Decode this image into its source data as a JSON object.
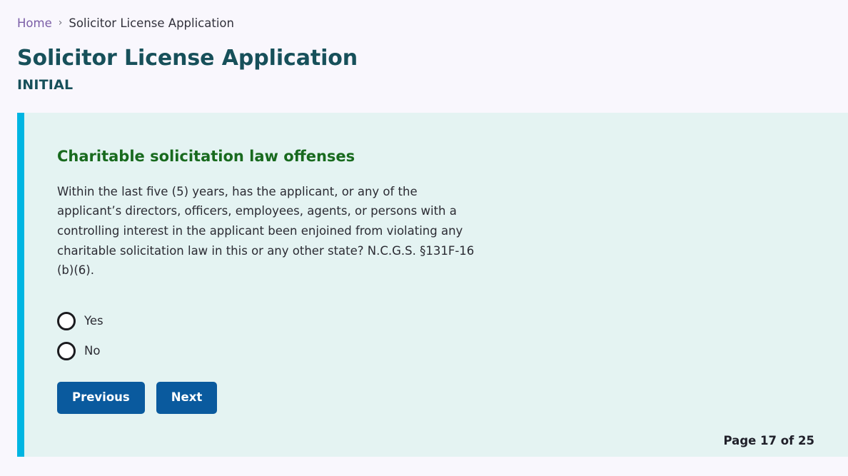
{
  "breadcrumb": {
    "home_label": "Home",
    "separator": "›",
    "current_label": "Solicitor License Application"
  },
  "header": {
    "title": "Solicitor License Application",
    "subtitle": "INITIAL"
  },
  "card": {
    "heading": "Charitable solicitation law offenses",
    "question": "Within the last five (5) years, has the applicant, or any of the applicant’s directors, officers, employees, agents, or persons with a controlling interest in the applicant been enjoined from violating any charitable solicitation law in this or any other state? N.C.G.S. §131F-16 (b)(6).",
    "options": [
      {
        "label": "Yes",
        "value": "yes",
        "selected": false
      },
      {
        "label": "No",
        "value": "no",
        "selected": false
      }
    ],
    "buttons": {
      "previous_label": "Previous",
      "next_label": "Next"
    },
    "page_counter": "Page 17 of 25"
  },
  "colors": {
    "page_background": "#f9f7fd",
    "card_background": "#e4f3f2",
    "card_accent_bar": "#00b5e2",
    "heading_green": "#186a1e",
    "title_teal": "#17505a",
    "button_blue": "#0a5a9e",
    "breadcrumb_link": "#7b5ea7"
  }
}
